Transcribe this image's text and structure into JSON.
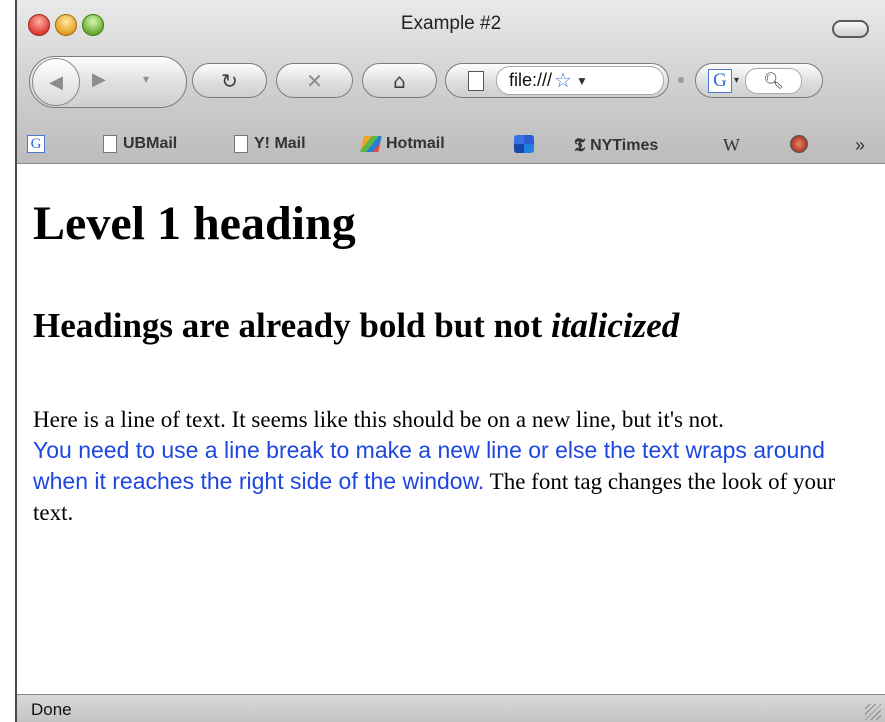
{
  "window": {
    "title": "Example #2"
  },
  "toolbar": {
    "back_icon": "back-arrow-icon",
    "forward_icon": "forward-arrow-icon",
    "reload_glyph": "↻",
    "stop_glyph": "✕",
    "home_glyph": "⌂",
    "url": "file:///",
    "search_engine": "G"
  },
  "bookmarks": [
    {
      "label": "",
      "icon": "google-icon"
    },
    {
      "label": "UBMail",
      "icon": "page-icon"
    },
    {
      "label": "Y! Mail",
      "icon": "page-icon"
    },
    {
      "label": "Hotmail",
      "icon": "hotmail-icon"
    },
    {
      "label": "",
      "icon": "msn-icon"
    },
    {
      "label": "NYTimes",
      "icon": "nyt-icon"
    },
    {
      "label": "",
      "icon": "wikipedia-icon"
    },
    {
      "label": "",
      "icon": "circle-icon"
    },
    {
      "label": "»",
      "icon": "more-icon"
    }
  ],
  "content": {
    "h1": "Level 1 heading",
    "h2_plain": "Headings are already bold but not ",
    "h2_italic": "italicized",
    "p_text": "Here is a line of text. It seems like this should be on a new line, but it's not.",
    "p_blue": "You need to use a line break to make a new line or else the text wraps around when it reaches the right side of the window.",
    "p_tail": " The font tag changes the look of your text."
  },
  "status": {
    "text": "Done"
  },
  "colors": {
    "font_blue": "#1e47e0"
  }
}
